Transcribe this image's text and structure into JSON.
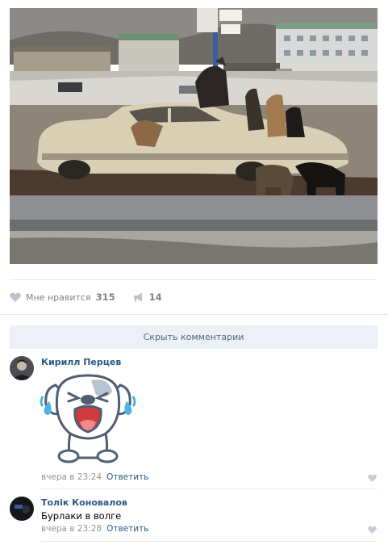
{
  "post": {
    "image": {
      "description_icon": "photo-of-dogs-on-car"
    },
    "actions": {
      "like_label": "Мне нравится",
      "like_count": "315",
      "share_count": "14"
    },
    "hide_comments_label": "Скрыть комментарии"
  },
  "comments": [
    {
      "author": "Кирилл Перцев",
      "sticker": "crying-dog-sticker",
      "time": "вчера в 23:24",
      "reply_label": "Ответить"
    },
    {
      "author": "Толік Коновалов",
      "text": "Бурлаки в волге",
      "time": "вчера в 23:28",
      "reply_label": "Ответить"
    }
  ],
  "colors": {
    "link": "#2a5885",
    "muted": "#939393",
    "button_bg": "#edf0f5",
    "icon": "#b8c2cf"
  }
}
